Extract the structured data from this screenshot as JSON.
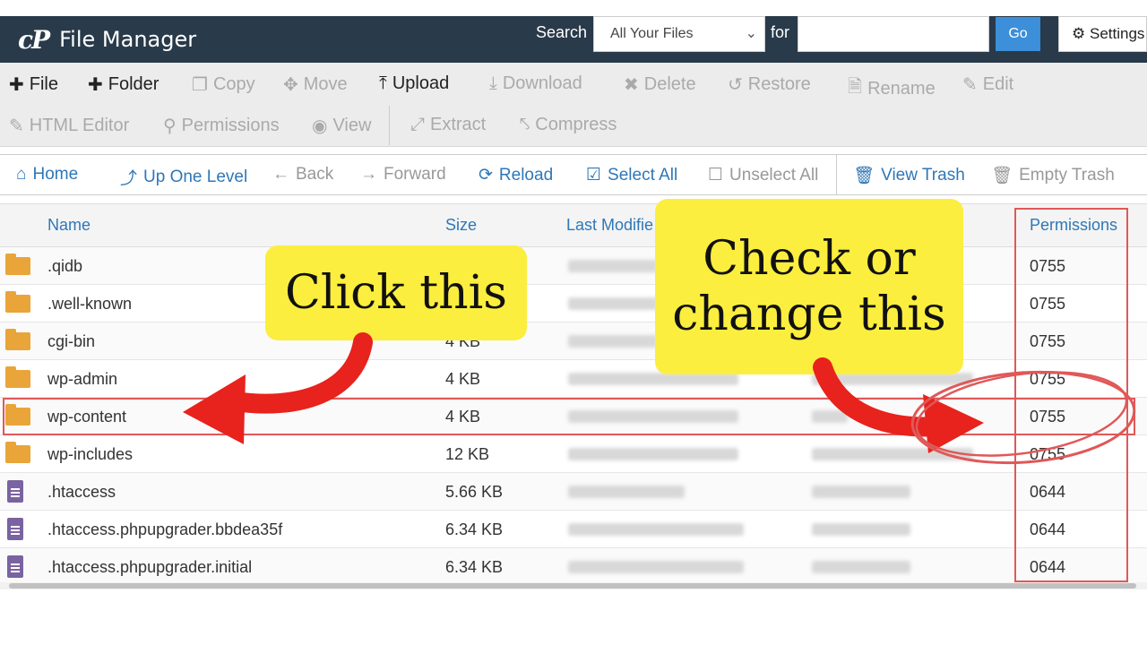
{
  "header": {
    "logo_mark": "cP",
    "app_title": "File Manager",
    "search_label": "Search",
    "search_scope": "All Your Files",
    "for_label": "for",
    "search_value": "",
    "go_label": "Go",
    "settings_label": "Settings"
  },
  "toolbar": {
    "file": "File",
    "folder": "Folder",
    "copy": "Copy",
    "move": "Move",
    "upload": "Upload",
    "download": "Download",
    "delete": "Delete",
    "restore": "Restore",
    "rename": "Rename",
    "edit": "Edit",
    "html_editor": "HTML Editor",
    "permissions": "Permissions",
    "view": "View",
    "extract": "Extract",
    "compress": "Compress"
  },
  "nav": {
    "home": "Home",
    "up_one_level": "Up One Level",
    "back": "Back",
    "forward": "Forward",
    "reload": "Reload",
    "select_all": "Select All",
    "unselect_all": "Unselect All",
    "view_trash": "View Trash",
    "empty_trash": "Empty Trash"
  },
  "table": {
    "columns": {
      "name": "Name",
      "size": "Size",
      "last_modified": "Last Modifie",
      "permissions": "Permissions"
    },
    "rows": [
      {
        "type": "folder",
        "name": ".qidb",
        "size": "",
        "permissions": "0755"
      },
      {
        "type": "folder",
        "name": ".well-known",
        "size": "",
        "permissions": "0755"
      },
      {
        "type": "folder",
        "name": "cgi-bin",
        "size": "4 KB",
        "permissions": "0755"
      },
      {
        "type": "folder",
        "name": "wp-admin",
        "size": "4 KB",
        "permissions": "0755"
      },
      {
        "type": "folder",
        "name": "wp-content",
        "size": "4 KB",
        "permissions": "0755"
      },
      {
        "type": "folder",
        "name": "wp-includes",
        "size": "12 KB",
        "permissions": "0755"
      },
      {
        "type": "file",
        "name": ".htaccess",
        "size": "5.66 KB",
        "permissions": "0644"
      },
      {
        "type": "file",
        "name": ".htaccess.phpupgrader.bbdea35f",
        "size": "6.34 KB",
        "permissions": "0644"
      },
      {
        "type": "file",
        "name": ".htaccess.phpupgrader.initial",
        "size": "6.34 KB",
        "permissions": "0644"
      }
    ]
  },
  "annotations": {
    "callout_1": "Click this",
    "callout_2_line1": "Check or",
    "callout_2_line2": "change this"
  },
  "colors": {
    "header_bg": "#293a4a",
    "link_blue": "#2e77b8",
    "highlight_red": "#e05858",
    "callout_yellow": "#fbee3e",
    "arrow_red": "#e8221c",
    "folder": "#e9a53a",
    "file": "#7a63a0"
  }
}
